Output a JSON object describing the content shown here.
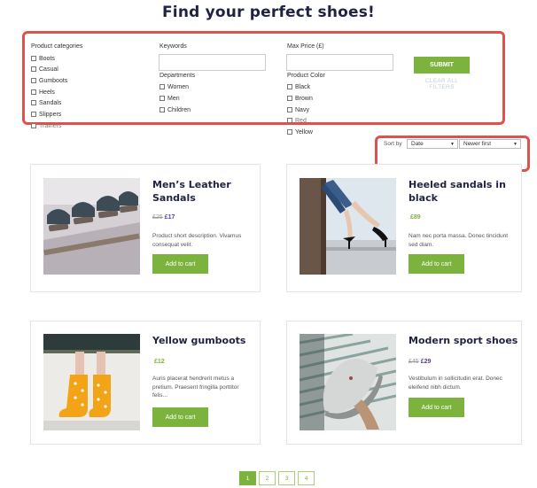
{
  "title": "Find your perfect shoes!",
  "filters": {
    "categories_label": "Product categories",
    "categories": [
      "Boots",
      "Casual",
      "Gumboots",
      "Heels",
      "Sandals",
      "Slippers",
      "Trainers"
    ],
    "keywords_label": "Keywords",
    "keywords_value": "",
    "departments_label": "Departments",
    "departments": [
      "Women",
      "Men",
      "Children"
    ],
    "max_price_label": "Max Price (£)",
    "max_price_value": "",
    "color_label": "Product Color",
    "colors": [
      "Black",
      "Brown",
      "Navy",
      "Red",
      "Yellow"
    ],
    "submit_label": "SUBMIT",
    "clear_label": "CLEAR ALL FILTERS"
  },
  "sort": {
    "label": "Sort by",
    "field_value": "Date",
    "order_value": "Newer first"
  },
  "products": [
    {
      "title_line1": "Men’s Leather",
      "title_line2": "Sandals",
      "old_price": "£25",
      "price": "£17",
      "desc_line1": "Product short description. Vivamus",
      "desc_line2": "consequat velit.",
      "desc_line3": "",
      "cart_label": "Add to cart",
      "image": "sandals-photo"
    },
    {
      "title_line1": "Heeled sandals in",
      "title_line2": "black",
      "old_price": "",
      "price": "£89",
      "desc_line1": "Nam nec porta massa. Donec tincidunt",
      "desc_line2": "sed diam.",
      "desc_line3": "",
      "cart_label": "Add to cart",
      "image": "heels-photo"
    },
    {
      "title_line1": "Yellow gumboots",
      "title_line2": "",
      "old_price": "",
      "price": "£12",
      "desc_line1": "Auris placerat hendrerit metus a",
      "desc_line2": "pretium. Praesent fringilla porttitor",
      "desc_line3": "felis...",
      "cart_label": "Add to cart",
      "image": "gumboots-photo"
    },
    {
      "title_line1": "Modern sport shoes",
      "title_line2": "",
      "old_price": "£45",
      "price": "£29",
      "desc_line1": "Vestibulum in sollicitudin erat. Donec",
      "desc_line2": "eleifend nibh dictum.",
      "desc_line3": "",
      "cart_label": "Add to cart",
      "image": "sneaker-photo"
    }
  ],
  "pagination": {
    "pages": [
      "1",
      "2",
      "3",
      "4"
    ],
    "current": "1"
  },
  "colors": {
    "accent": "#7cb33c",
    "highlight": "#e2504b",
    "price": "#5b3aa8",
    "heading": "#1f2340"
  }
}
